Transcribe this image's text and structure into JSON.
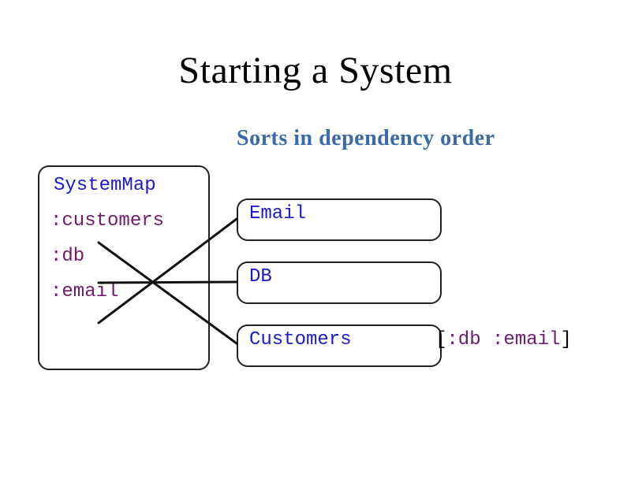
{
  "title": "Starting a System",
  "subtitle": "Sorts in dependency order",
  "systemmap": {
    "label": "SystemMap",
    "keys": [
      ":customers",
      ":db",
      ":email"
    ]
  },
  "components": {
    "email": "Email",
    "db": "DB",
    "customers": "Customers"
  },
  "customers_deps": {
    "open": "[",
    "db": ":db",
    "space": " ",
    "email": ":email",
    "close": "]"
  },
  "connections": [
    {
      "from": ":customers",
      "to": "Customers"
    },
    {
      "from": ":db",
      "to": "DB"
    },
    {
      "from": ":email",
      "to": "Email"
    }
  ]
}
